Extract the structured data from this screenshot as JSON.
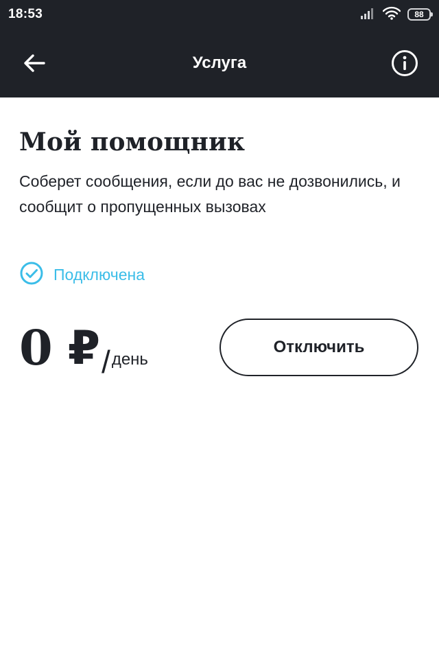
{
  "status_bar": {
    "time": "18:53",
    "battery": "88",
    "icons": [
      "signal-icon",
      "wifi-icon",
      "battery-icon"
    ]
  },
  "app_bar": {
    "title": "Услуга",
    "back_icon": "arrow-left-icon",
    "info_icon": "info-icon"
  },
  "service": {
    "title": "Мой помощник",
    "description": "Соберет сообщения, если до вас не дозвонились, и сообщит о пропущенных вызовах",
    "status": "Подключена",
    "status_icon": "check-circle-icon",
    "price": {
      "value": "0",
      "currency": "₽",
      "separator": "/",
      "period": "день"
    },
    "action_label": "Отключить"
  },
  "colors": {
    "header_bg": "#1f2228",
    "accent": "#3bbde8",
    "text": "#1f2228",
    "background": "#ffffff"
  }
}
